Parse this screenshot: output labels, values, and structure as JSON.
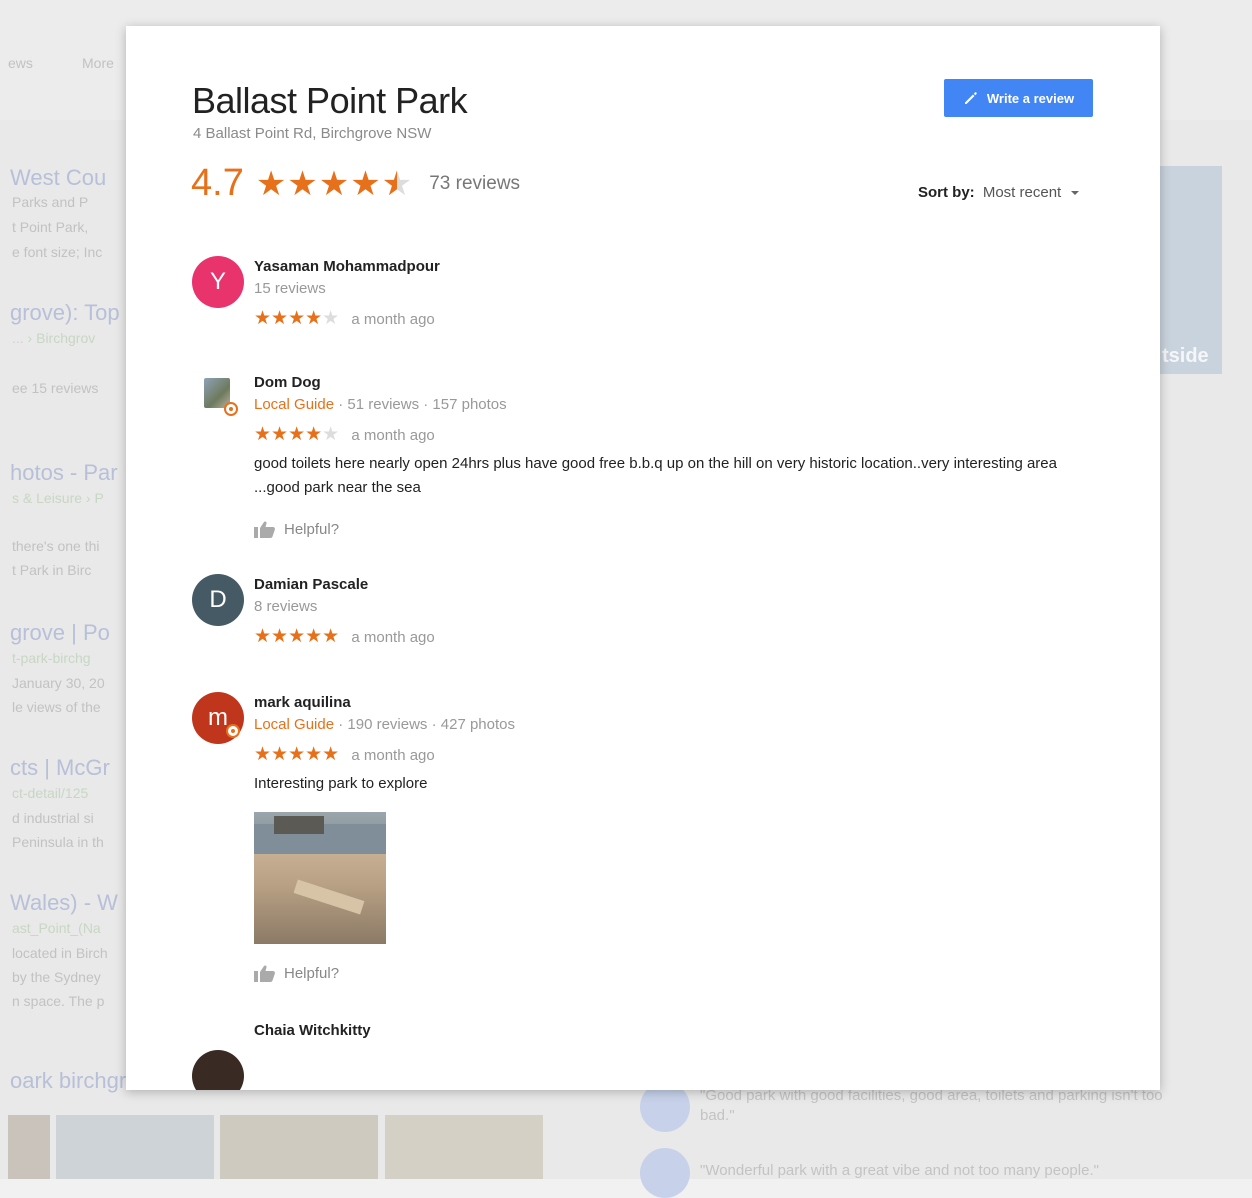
{
  "background": {
    "nav": [
      "ews",
      "More"
    ],
    "left_results": [
      "West Cou",
      "Parks and P",
      "t Point Park, ",
      "e font size; Inc",
      "grove): Top",
      "... › Birchgrov",
      "ee 15 reviews",
      "hotos - Par",
      "s & Leisure › P",
      "there's one thi",
      "t Park in Birc",
      "grove | Po",
      "t-park-birchg",
      "January 30, 20",
      "le views of the",
      "cts | McGr",
      "ct-detail/125",
      "d industrial si",
      "Peninsula in th",
      "Wales) - W",
      "ast_Point_(Na",
      "located in Birch",
      "by the Sydney",
      "n space. The p",
      "oark birchgr"
    ],
    "right_photo_label": "tside",
    "quotes": [
      "\"Good park with good facilities, good area, toilets and parking isn't too bad.\"",
      "\"Wonderful park with a great vibe and not too many people.\""
    ]
  },
  "modal": {
    "title": "Ballast Point Park",
    "address": "4 Ballast Point Rd, Birchgrove NSW",
    "write_review_label": "Write a review",
    "rating": "4.7",
    "stars_full": "★★★★",
    "review_count": "73 reviews",
    "sort_label": "Sort by:",
    "sort_value": "Most recent",
    "helpful_label": "Helpful?",
    "reviews": [
      {
        "initial": "Y",
        "avatar_color": "#e8336d",
        "name": "Yasaman Mohammadpour",
        "meta": "15 reviews",
        "stars": "★★★★",
        "stars_off": "★",
        "time": "a month ago"
      },
      {
        "initial": "",
        "name": "Dom Dog",
        "guide": "Local Guide",
        "meta": " · 51 reviews · 157 photos",
        "stars": "★★★★",
        "stars_off": "★",
        "time": "a month ago",
        "text": "good toilets here nearly open 24hrs plus have good free b.b.q up on the hill on very historic location..very interesting area ...good park near the sea"
      },
      {
        "initial": "D",
        "avatar_color": "#455a64",
        "name": "Damian Pascale",
        "meta": "8 reviews",
        "stars": "★★★★★",
        "stars_off": "",
        "time": "a month ago"
      },
      {
        "initial": "m",
        "avatar_color": "#c0361d",
        "name": "mark aquilina",
        "guide": "Local Guide",
        "meta": " · 190 reviews · 427 photos",
        "stars": "★★★★★",
        "stars_off": "",
        "time": "a month ago",
        "text": "Interesting park to explore"
      },
      {
        "initial": "",
        "avatar_color": "#3a2a24",
        "name": "Chaia Witchkitty"
      }
    ]
  },
  "colors": {
    "accent_orange": "#e7711b",
    "button_blue": "#4285f4"
  },
  "icons": [
    "pencil-icon",
    "caret-down-icon",
    "thumbs-up-icon",
    "local-guide-badge-icon"
  ]
}
